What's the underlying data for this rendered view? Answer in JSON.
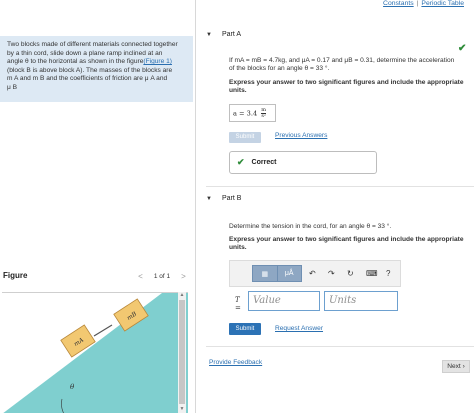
{
  "toplinks": {
    "constants": "Constants",
    "separator": "|",
    "periodic_table": "Periodic Table"
  },
  "problem": {
    "line1": "Two blocks made of different materials connected together",
    "line2": "by a thin cord, slide down a plane ramp inclined at an",
    "line3_pre": "angle θ to the horizontal as shown in the figure",
    "figure_link": "(Figure 1)",
    "line4": "(block B is above block A). The masses of the blocks are",
    "line5": "m A and m B and the coefficients of friction are μ A and",
    "line6": "μ B"
  },
  "figure": {
    "title": "Figure",
    "pager": {
      "prev": "<",
      "label": "1 of 1",
      "next": ">"
    },
    "block_a_label": "mA",
    "block_b_label": "mB",
    "angle_label": "θ",
    "colors": {
      "ramp": "#7fcfcf",
      "block": "#f2c871",
      "block_edge": "#b8873a",
      "cord": "#555555"
    },
    "scroll": {
      "up": "▲",
      "down": "▼"
    }
  },
  "partA": {
    "caret": "▼",
    "title": "Part A",
    "check_icon": "✔",
    "question_line1": "If mA = mB = 4.7kg, and μA = 0.17 and μB = 0.31, determine the acceleration",
    "question_line2": "of the blocks for an angle θ = 33 °.",
    "instruction_line1": "Express your answer to two significant figures and include the appropriate",
    "instruction_line2": "units.",
    "answer_lhs": "a =",
    "answer_value": "3.4",
    "answer_unit_num": "m",
    "answer_unit_den": "s²",
    "submit_label": "Submit",
    "previous_answers": "Previous Answers",
    "correct_icon": "✔",
    "correct_label": "Correct"
  },
  "partB": {
    "caret": "▼",
    "title": "Part B",
    "question": "Determine the tension in the cord, for an angle θ = 33 °.",
    "instruction_line1": "Express your answer to two significant figures and include the appropriate",
    "instruction_line2": "units.",
    "toolbar": {
      "template_icon": "▦",
      "mu_label": "μÅ",
      "undo_icon": "↶",
      "redo_icon": "↷",
      "reset_icon": "↻",
      "keyboard_icon": "⌨",
      "help_icon": "?"
    },
    "variable_label": "T =",
    "value_placeholder": "Value",
    "units_placeholder": "Units",
    "submit_label": "Submit",
    "request_answer": "Request Answer"
  },
  "footer": {
    "feedback": "Provide Feedback",
    "next": "Next ›"
  }
}
